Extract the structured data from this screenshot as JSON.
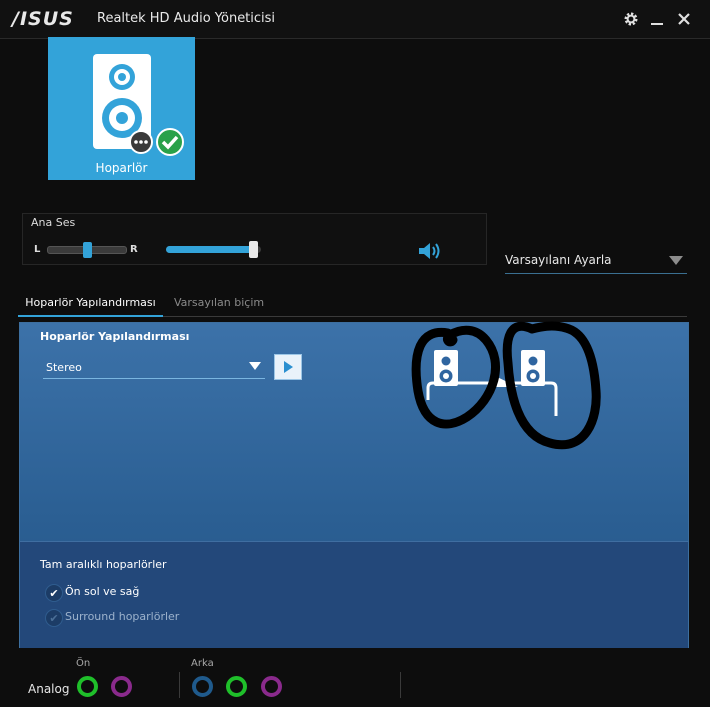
{
  "window": {
    "brand": "/ISUS",
    "title": "Realtek HD Audio Yöneticisi",
    "controls": [
      "gear-icon",
      "minimize-icon",
      "close-icon"
    ]
  },
  "device": {
    "label": "Hoparlör",
    "icon": "speaker-device-icon",
    "status_icons": [
      "chat-bubble-icon",
      "check-circle-icon"
    ]
  },
  "main_volume": {
    "title": "Ana Ses",
    "left_label": "L",
    "right_label": "R",
    "balance": 0.5,
    "volume": 0.97,
    "mute_icon": "speaker-volume-icon"
  },
  "default_device": {
    "label": "Varsayılanı Ayarla"
  },
  "tabs": [
    {
      "label": "Hoparlör Yapılandırması",
      "active": true
    },
    {
      "label": "Varsayılan biçim",
      "active": false
    }
  ],
  "config": {
    "title": "Hoparlör Yapılandırması",
    "selected": "Stereo",
    "play_icon": "play-icon"
  },
  "full_range": {
    "title": "Tam aralıklı hoparlörler",
    "options": [
      {
        "label": "Ön sol ve sağ",
        "checked": true,
        "enabled": true
      },
      {
        "label": "Surround hoparlörler",
        "checked": true,
        "enabled": false
      }
    ]
  },
  "jacks": {
    "analog_label": "Analog",
    "front_label": "Ön",
    "back_label": "Arka",
    "colors": {
      "green": "#1fbf2a",
      "purple": "#8a2a8c",
      "blue": "#1f5a8c"
    }
  },
  "colors": {
    "accent": "#33a3d9",
    "panel": "#2f65a0"
  }
}
